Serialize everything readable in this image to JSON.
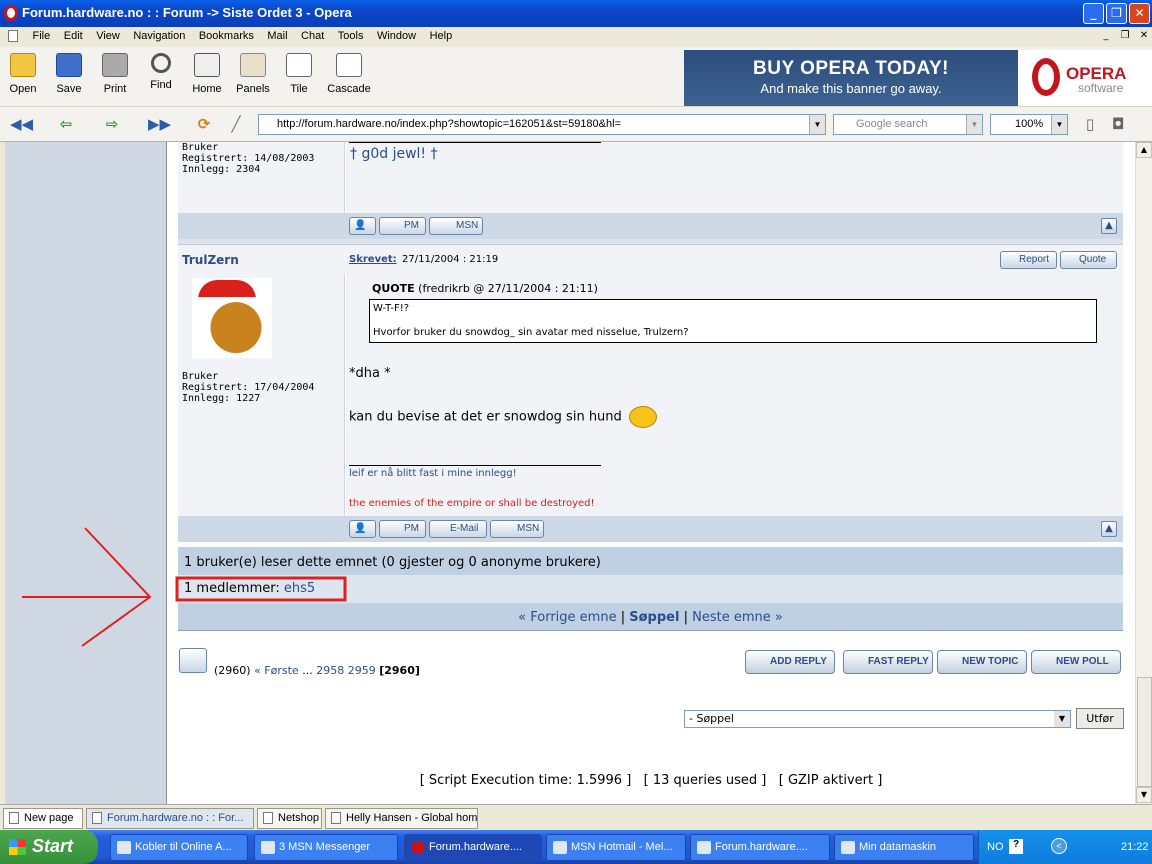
{
  "window": {
    "title": "Forum.hardware.no : : Forum -> Siste Ordet 3 - Opera"
  },
  "menu": [
    "File",
    "Edit",
    "View",
    "Navigation",
    "Bookmarks",
    "Mail",
    "Chat",
    "Tools",
    "Window",
    "Help"
  ],
  "toolbar": {
    "open": "Open",
    "save": "Save",
    "print": "Print",
    "find": "Find",
    "home": "Home",
    "panels": "Panels",
    "tile": "Tile",
    "cascade": "Cascade"
  },
  "banner": {
    "line1": "BUY OPERA TODAY!",
    "line2": "And make this banner go away.",
    "logo_main": "OPERA",
    "logo_sub": "software"
  },
  "address": {
    "url": "http://forum.hardware.no/index.php?showtopic=162051&st=59180&hl=",
    "search_placeholder": "Google search",
    "zoom": "100%"
  },
  "post1": {
    "rank": "Bruker",
    "registered": "Registrert: 14/08/2003",
    "posts": "Innlegg: 2304",
    "signature": "† g0d jewl! †",
    "buttons": {
      "pm": "PM",
      "msn": "MSN"
    }
  },
  "post2": {
    "author": "TrulZern",
    "written_label": "Skrevet:",
    "written_date": "27/11/2004 : 21:19",
    "report": "Report",
    "quote": "Quote",
    "quote_header": "QUOTE",
    "quote_source": "(fredrikrb @ 27/11/2004 : 21:11)",
    "quote_line1": "W-T-F!?",
    "quote_line2": "Hvorfor bruker du snowdog_ sin avatar med nisselue, Trulzern?",
    "body1": "*dha *",
    "body2": "kan du bevise at det er snowdog sin hund",
    "sig1": "leif er nå blitt fast i mine innlegg!",
    "sig2": "the enemies of the empire or shall be destroyed!",
    "rank": "Bruker",
    "registered": "Registrert: 17/04/2004",
    "posts": "Innlegg: 1227",
    "buttons": {
      "pm": "PM",
      "email": "E-Mail",
      "msn": "MSN"
    }
  },
  "readers": {
    "summary": "1 bruker(e) leser dette emnet (0 gjester og 0 anonyme brukere)",
    "members_label": "1 medlemmer:",
    "member": "ehs5"
  },
  "topicnav": {
    "prev": "« Forrige emne",
    "sep": "|",
    "current": "Søppel",
    "next": "Neste emne »"
  },
  "pagination": {
    "count": "(2960)",
    "first": "« Første",
    "dots": "...",
    "p1": "2958",
    "p2": "2959",
    "current": "[2960]"
  },
  "actions": {
    "add_reply": "ADD REPLY",
    "fast_reply": "FAST REPLY",
    "new_topic": "NEW TOPIC",
    "new_poll": "NEW POLL"
  },
  "forumjump": {
    "selected": "- Søppel",
    "go": "Utfør"
  },
  "footer": {
    "stats": "[ Script Execution time: 1.5996 ]   [ 13 queries used ]   [ GZIP aktivert ]"
  },
  "tabs": [
    "New page",
    "Forum.hardware.no : : For...",
    "Netshop",
    "Helly Hansen - Global home"
  ],
  "taskbar": {
    "start": "Start",
    "items": [
      "Kobler til Online A...",
      "3 MSN Messenger",
      "Forum.hardware....",
      "MSN Hotmail - Mel...",
      "Forum.hardware....",
      "Min datamaskin"
    ],
    "lang": "NO",
    "clock": "21:22"
  },
  "colors": {
    "accent": "#2a4e8a",
    "highlight": "#e02020",
    "rowbg": "#cdd9e6"
  }
}
